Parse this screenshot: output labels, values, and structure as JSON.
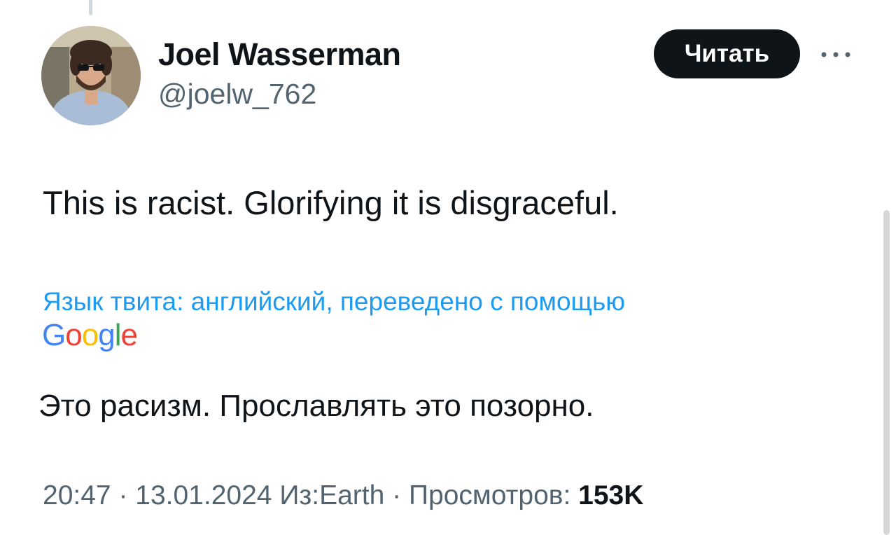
{
  "author": {
    "display_name": "Joel Wasserman",
    "handle": "@joelw_762"
  },
  "actions": {
    "follow_label": "Читать",
    "more_icon": "more-dots-icon"
  },
  "tweet": {
    "text": "This is racist. Glorifying it is disgraceful.",
    "translation_note": "Язык твита: английский, переведено с помощью",
    "translation_provider": [
      "G",
      "o",
      "o",
      "g",
      "l",
      "e"
    ],
    "translation_provider_colors": [
      "#4285F4",
      "#EA4335",
      "#FBBC05",
      "#4285F4",
      "#34A853",
      "#EA4335"
    ],
    "translated_text": "Это расизм. Прославлять это позорно."
  },
  "meta": {
    "time": "20:47",
    "separator": " · ",
    "date": "13.01.2024",
    "location": "Из:Earth",
    "views_label": "Просмотров:",
    "views_count": "153K"
  },
  "colors": {
    "link": "#1d9bf0",
    "secondary_text": "#536471",
    "primary_text": "#0f1419",
    "button_bg": "#0f1419"
  }
}
